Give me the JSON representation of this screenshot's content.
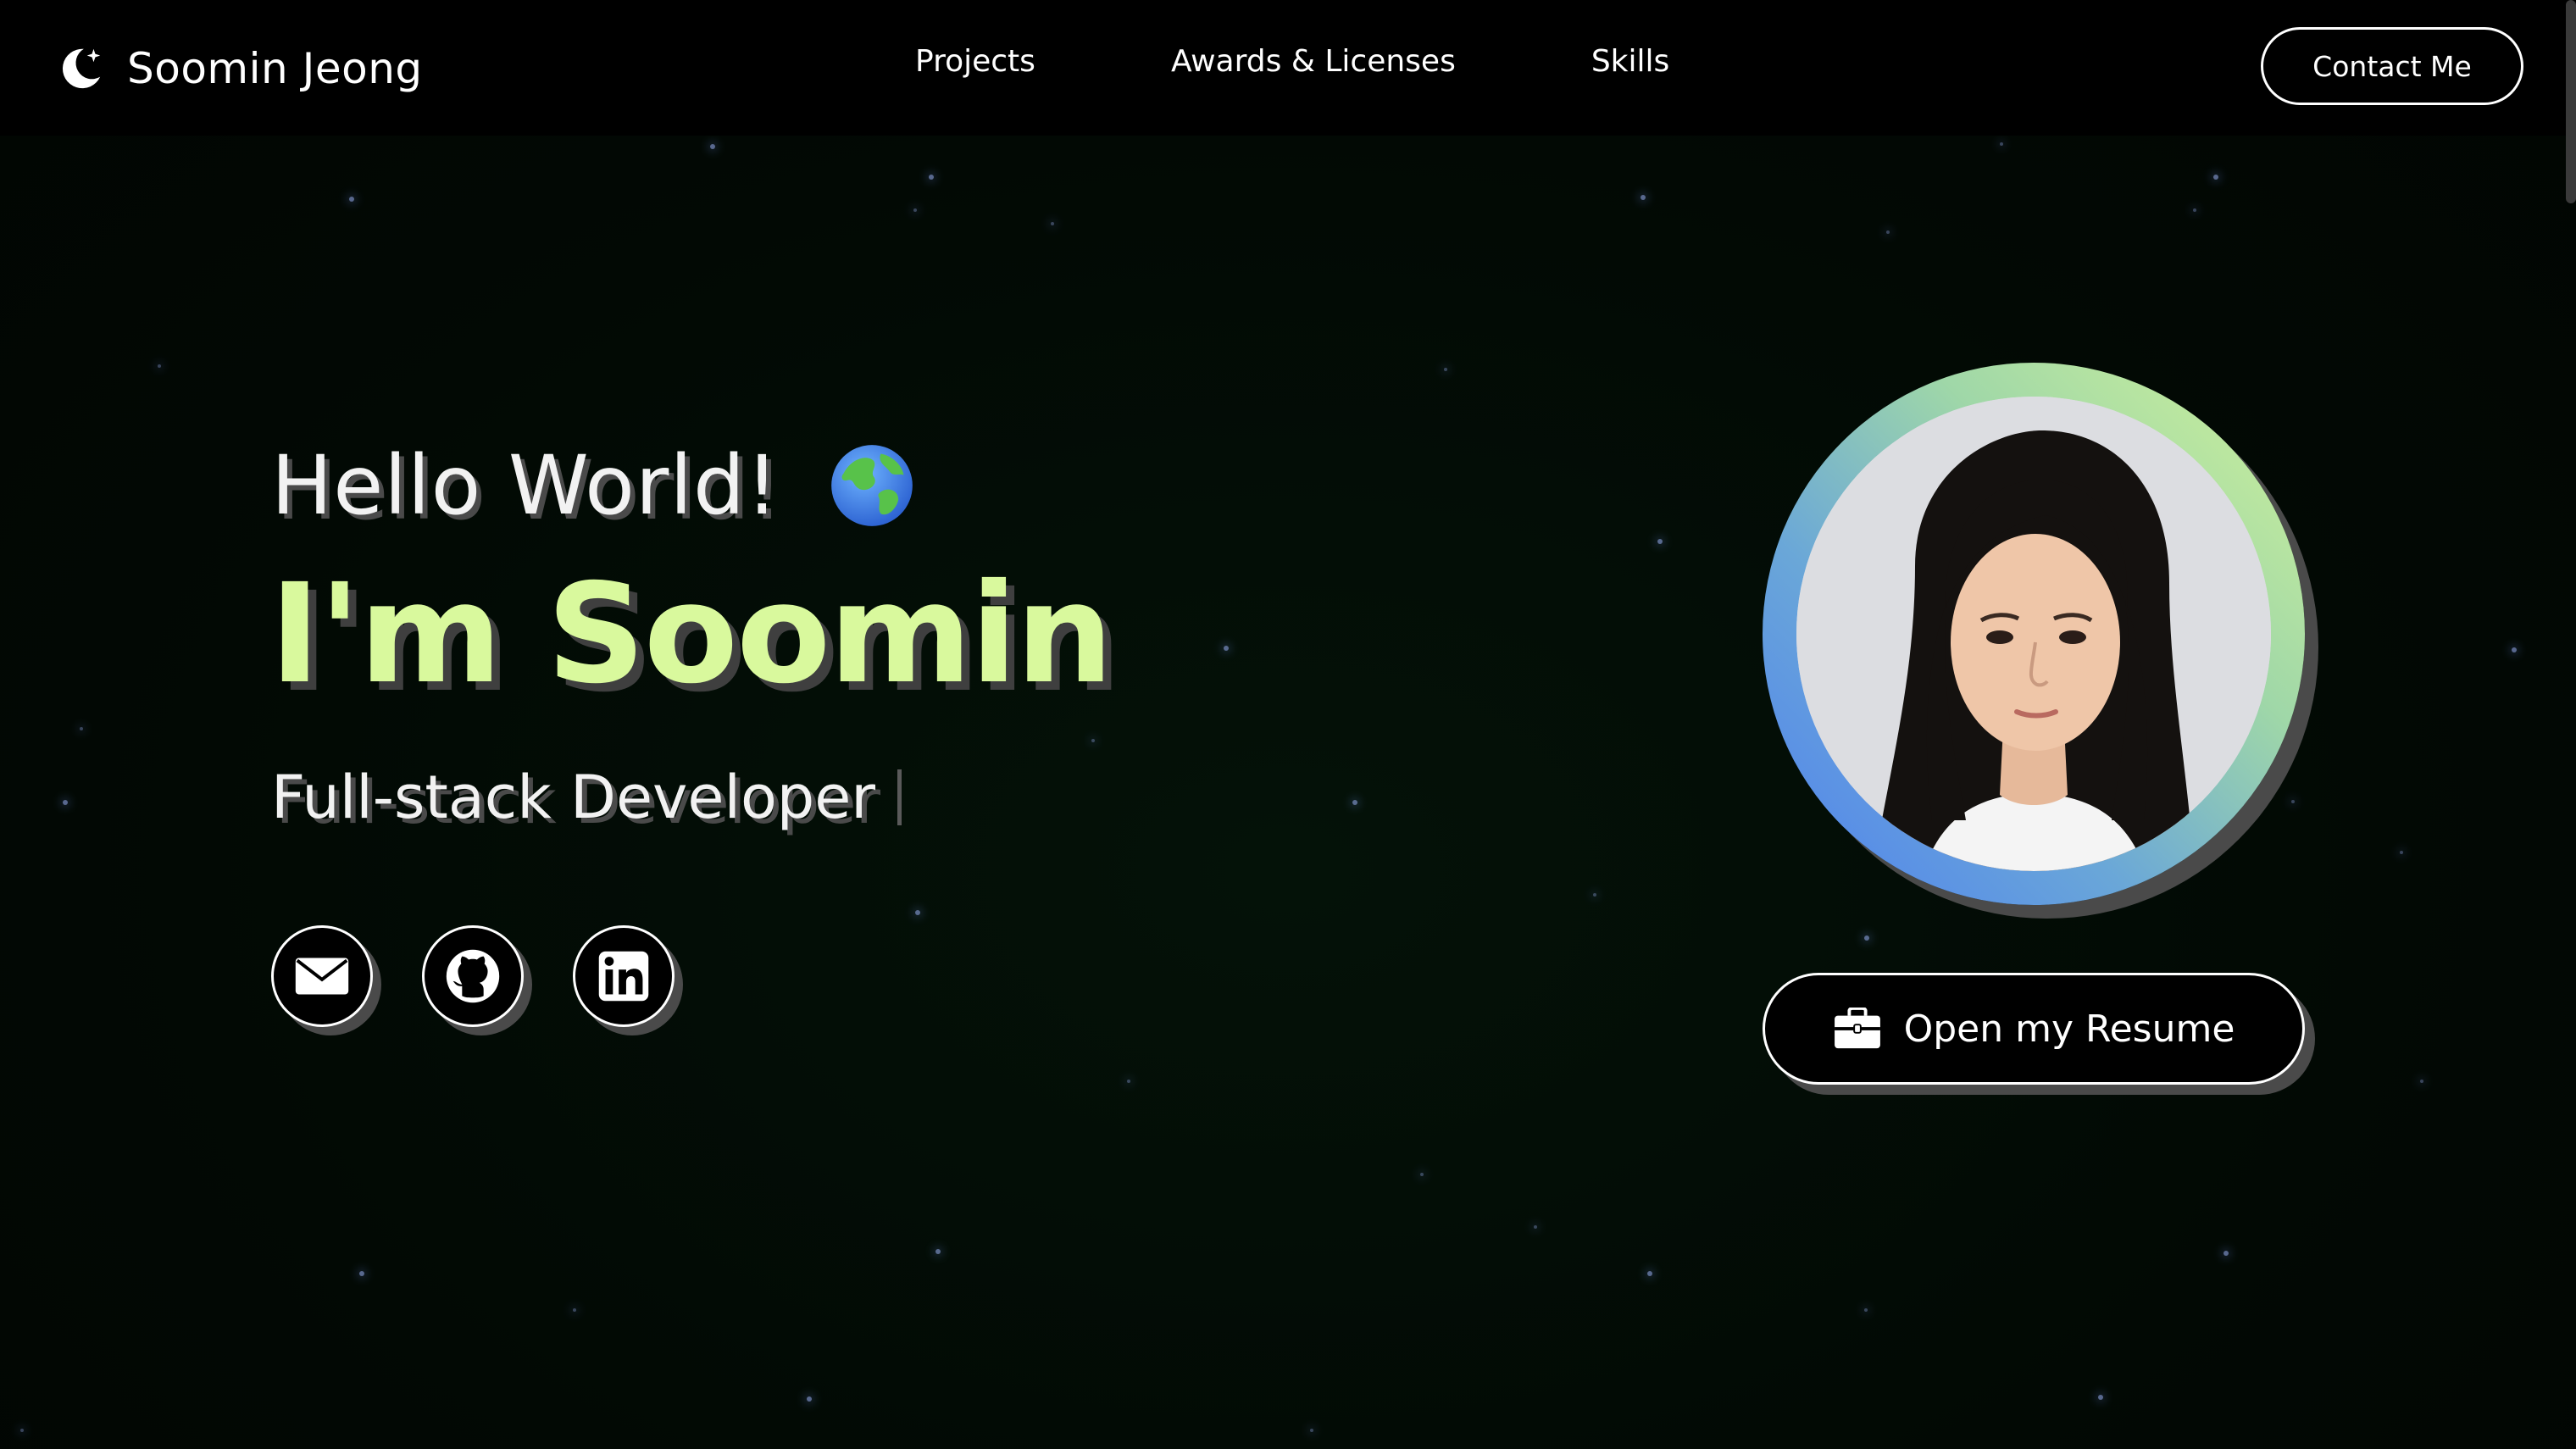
{
  "brand": {
    "name": "Soomin Jeong",
    "icon": "crescent-moon-icon"
  },
  "nav": {
    "links": [
      {
        "label": "Projects"
      },
      {
        "label": "Awards & Licenses"
      },
      {
        "label": "Skills"
      }
    ],
    "contact_label": "Contact Me"
  },
  "hero": {
    "greeting": "Hello World!",
    "greeting_icon": "globe-icon",
    "headline": "I'm Soomin",
    "role": "Full-stack Developer",
    "socials": [
      {
        "icon": "mail-icon"
      },
      {
        "icon": "github-icon"
      },
      {
        "icon": "linkedin-icon"
      }
    ],
    "resume_label": "Open my Resume",
    "resume_icon": "briefcase-icon"
  },
  "colors": {
    "headline": "#d9f99d",
    "background": "#020a04",
    "ring_start": "#d0f29a",
    "ring_end": "#4e7ff0"
  }
}
